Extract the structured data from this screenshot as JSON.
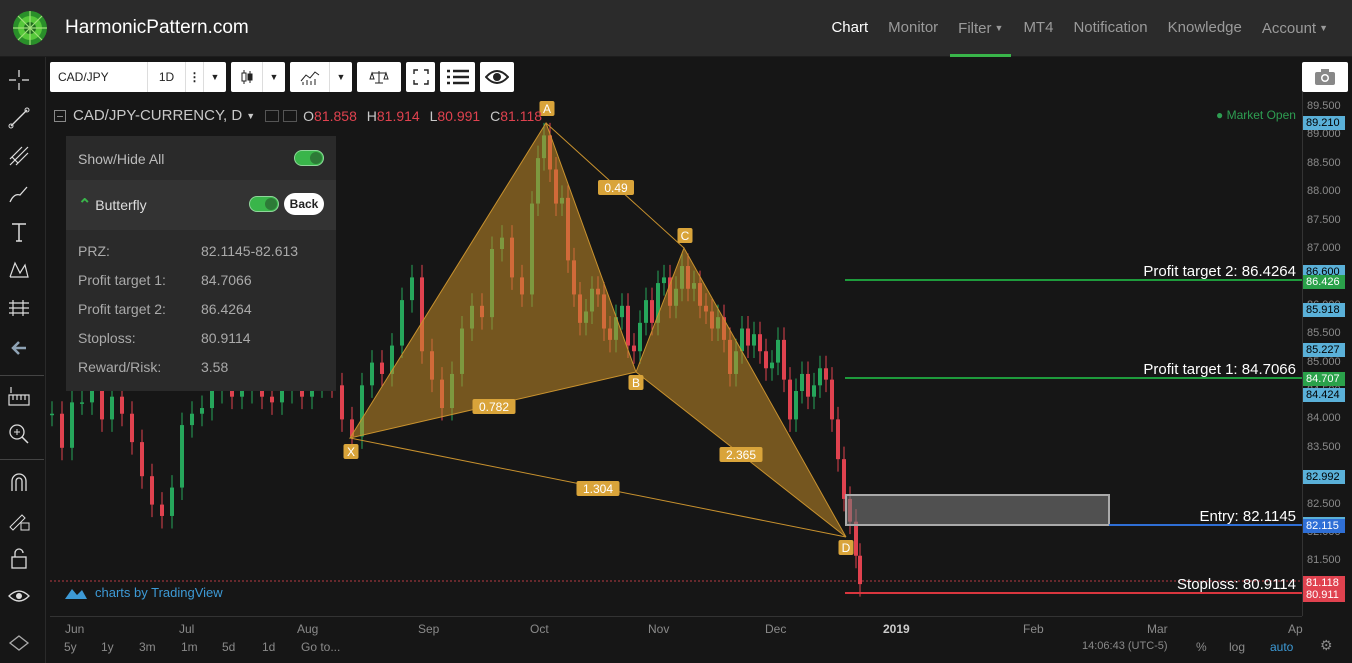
{
  "header": {
    "brand": "HarmonicPattern.com",
    "nav": [
      {
        "label": "Chart",
        "active": true,
        "dropdown": false
      },
      {
        "label": "Monitor",
        "active": false,
        "dropdown": false
      },
      {
        "label": "Filter",
        "active": false,
        "dropdown": true
      },
      {
        "label": "MT4",
        "active": false,
        "dropdown": false
      },
      {
        "label": "Notification",
        "active": false,
        "dropdown": false
      },
      {
        "label": "Knowledge",
        "active": false,
        "dropdown": false
      },
      {
        "label": "Account",
        "active": false,
        "dropdown": true
      }
    ]
  },
  "toolbar": {
    "symbol": "CAD/JPY",
    "interval": "1D"
  },
  "legend": {
    "title": "CAD/JPY-CURRENCY, D",
    "open_label": "O",
    "open": "81.858",
    "high_label": "H",
    "high": "81.914",
    "low_label": "L",
    "low": "80.991",
    "close_label": "C",
    "close": "81.118",
    "status": "Market Open"
  },
  "panel": {
    "show_hide_all": "Show/Hide All",
    "pattern_name": "Butterfly",
    "back_label": "Back",
    "rows": [
      {
        "label": "PRZ:",
        "value": "82.1145-82.613"
      },
      {
        "label": "Profit target 1:",
        "value": "84.7066"
      },
      {
        "label": "Profit target 2:",
        "value": "86.4264"
      },
      {
        "label": "Stoploss:",
        "value": "80.9114"
      },
      {
        "label": "Reward/Risk:",
        "value": "3.58"
      }
    ]
  },
  "chart_data": {
    "type": "candlestick",
    "symbol": "CAD/JPY",
    "ylim": [
      81.0,
      89.5
    ],
    "y_ticks": [
      "89.500",
      "89.000",
      "88.500",
      "88.000",
      "87.500",
      "87.000",
      "86.500",
      "86.000",
      "85.500",
      "85.000",
      "84.500",
      "84.000",
      "83.500",
      "83.000",
      "82.500",
      "82.000",
      "81.500",
      "81.000"
    ],
    "x_ticks": [
      "Jun",
      "Jul",
      "Aug",
      "Sep",
      "Oct",
      "Nov",
      "Dec",
      "2019",
      "Feb",
      "Mar",
      "Ap"
    ],
    "pattern": {
      "name": "Butterfly",
      "points": [
        "X",
        "A",
        "B",
        "C",
        "D"
      ],
      "ratios": [
        "0.49",
        "0.782",
        "2.365",
        "1.304"
      ]
    },
    "levels": [
      {
        "label": "Profit target 2: 86.4264",
        "value": 86.4264,
        "color": "#1e9b3c"
      },
      {
        "label": "Profit target 1: 84.7066",
        "value": 84.7066,
        "color": "#1e9b3c"
      },
      {
        "label": "Entry: 82.1145",
        "value": 82.1145,
        "color": "#2f6fd6"
      },
      {
        "label": "Stoploss: 80.9114",
        "value": 80.9114,
        "color": "#d9363e"
      }
    ],
    "price_labels": [
      {
        "text": "89.210",
        "bg": "#5ab0d8"
      },
      {
        "text": "86.600",
        "bg": "#5ab0d8"
      },
      {
        "text": "86.426",
        "bg": "#2aa14a"
      },
      {
        "text": "85.918",
        "bg": "#5ab0d8"
      },
      {
        "text": "85.227",
        "bg": "#5ab0d8"
      },
      {
        "text": "84.707",
        "bg": "#2aa14a"
      },
      {
        "text": "84.424",
        "bg": "#5ab0d8"
      },
      {
        "text": "82.992",
        "bg": "#5ab0d8"
      },
      {
        "text": "82.156",
        "bg": "#5ab0d8"
      },
      {
        "text": "82.115",
        "bg": "#2f6fd6"
      },
      {
        "text": "81.118",
        "bg": "#e0424f"
      },
      {
        "text": "80.911",
        "bg": "#e0424f"
      }
    ]
  },
  "bottom": {
    "ranges": [
      "5y",
      "1y",
      "3m",
      "1m",
      "5d",
      "1d",
      "Go to..."
    ],
    "clock": "14:06:43 (UTC-5)",
    "percent": "%",
    "log": "log",
    "auto": "auto"
  },
  "attribution": "charts by TradingView"
}
